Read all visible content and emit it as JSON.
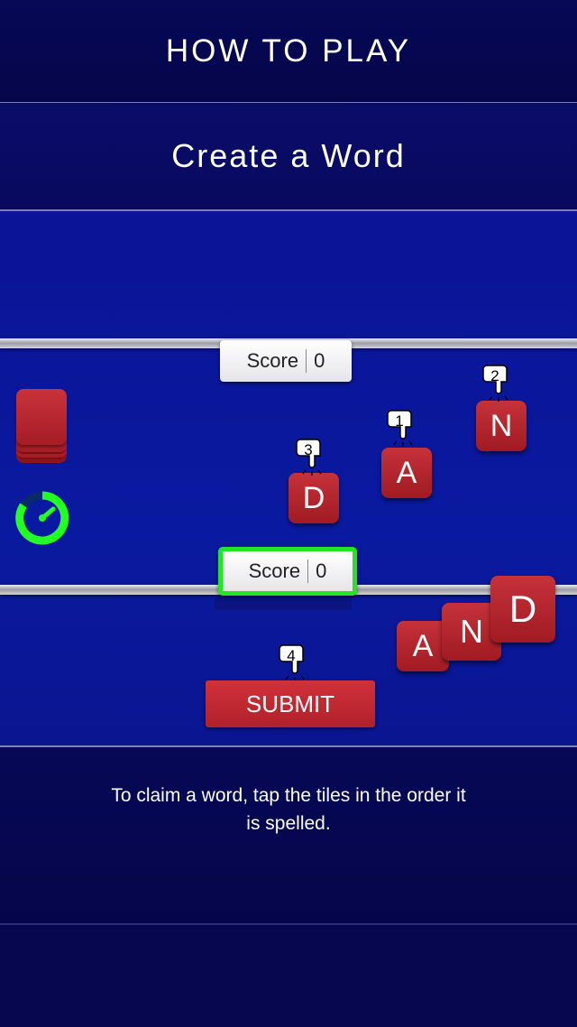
{
  "header": {
    "title": "HOW TO PLAY"
  },
  "subheader": {
    "title": "Create a Word"
  },
  "opponent_score": {
    "label": "Score",
    "value": "0"
  },
  "player_score": {
    "label": "Score",
    "value": "0"
  },
  "board_tiles": [
    {
      "letter": "A",
      "step": "1"
    },
    {
      "letter": "N",
      "step": "2"
    },
    {
      "letter": "D",
      "step": "3"
    }
  ],
  "word_tiles": [
    "A",
    "N",
    "D"
  ],
  "submit": {
    "label": "SUBMIT",
    "step": "4"
  },
  "timer": {
    "color": "#22ff22"
  },
  "instructions": "To claim a word, tap the tiles in the order it is spelled.",
  "colors": {
    "tile": "#b3242c",
    "background": "#0a1aa0",
    "highlight": "#22e622"
  },
  "icons": [
    "tile-deck-icon",
    "timer-icon",
    "pointing-hand-icon"
  ]
}
